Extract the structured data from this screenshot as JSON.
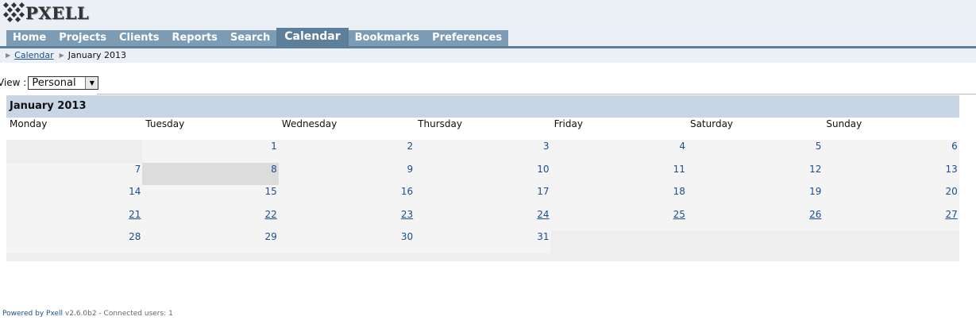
{
  "app": {
    "logo_text": "PXELL"
  },
  "nav": {
    "tabs": [
      {
        "label": "Home",
        "active": false
      },
      {
        "label": "Projects",
        "active": false
      },
      {
        "label": "Clients",
        "active": false
      },
      {
        "label": "Reports",
        "active": false
      },
      {
        "label": "Search",
        "active": false
      },
      {
        "label": "Calendar",
        "active": true
      },
      {
        "label": "Bookmarks",
        "active": false
      },
      {
        "label": "Preferences",
        "active": false
      }
    ]
  },
  "breadcrumb": {
    "link": "Calendar",
    "current": "January 2013"
  },
  "view": {
    "label": "View :",
    "selected": "Personal"
  },
  "calendar": {
    "title": "January 2013",
    "days_of_week": [
      "Monday",
      "Tuesday",
      "Wednesday",
      "Thursday",
      "Friday",
      "Saturday",
      "Sunday"
    ],
    "weeks": [
      [
        null,
        "1",
        "2",
        "3",
        "4",
        "5",
        "6"
      ],
      [
        "7",
        "8",
        "9",
        "10",
        "11",
        "12",
        "13"
      ],
      [
        "14",
        "15",
        "16",
        "17",
        "18",
        "19",
        "20"
      ],
      [
        "21",
        "22",
        "23",
        "24",
        "25",
        "26",
        "27"
      ],
      [
        "28",
        "29",
        "30",
        "31",
        null,
        null,
        null
      ]
    ],
    "today": "8",
    "underlined_week": 3
  },
  "footer": {
    "powered_link": "Powered by Pxell",
    "version_text": " v2.6.0b2 - Connected users: 1"
  },
  "colors": {
    "nav_tab": "#7b9cb4",
    "nav_tab_active": "#5d7f9a",
    "link": "#1a4f8a",
    "calendar_title_bg": "#c7d5e5"
  }
}
